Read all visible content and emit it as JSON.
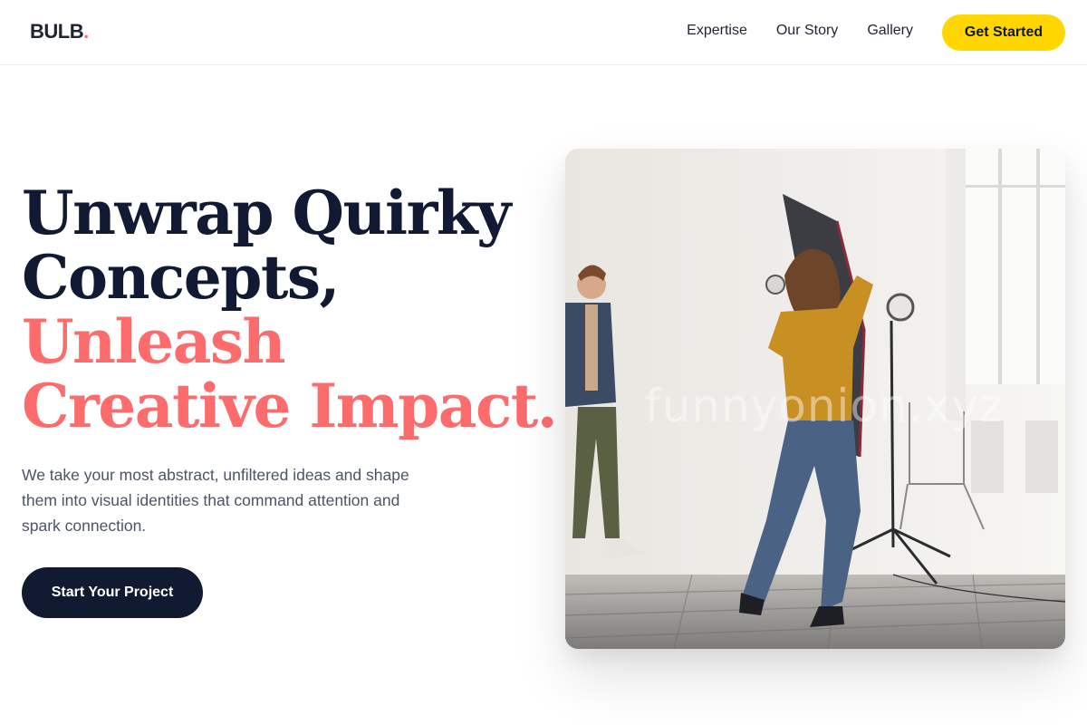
{
  "brand": {
    "name": "BULB",
    "dot": ".",
    "accent": "#ff6b6b"
  },
  "nav": {
    "links": [
      "Expertise",
      "Our Story",
      "Gallery"
    ],
    "cta_label": "Get Started",
    "cta_color": "#ffd600"
  },
  "hero": {
    "title_lines": [
      "Unwrap Quirky",
      "Concepts,"
    ],
    "highlight_lines": [
      "Unleash",
      "Creative Impact."
    ],
    "title_color": "#121a33",
    "highlight_color": "#fd6c6c",
    "description": "We take your most abstract, unfiltered ideas and shape them into visual identities that command attention and spark connection.",
    "cta_label": "Start Your Project",
    "cta_color": "#111a30"
  },
  "image": {
    "subject": "photo studio: photographer with softbox light photographing a male model",
    "watermark": "funnyonion.xyz"
  }
}
